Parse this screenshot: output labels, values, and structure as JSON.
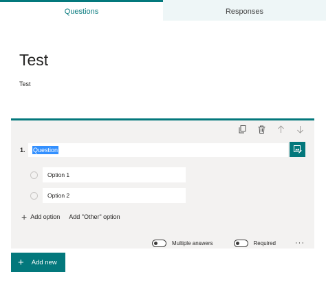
{
  "tabs": [
    {
      "label": "Questions",
      "active": true
    },
    {
      "label": "Responses",
      "active": false
    }
  ],
  "form": {
    "title": "Test",
    "description": "Test"
  },
  "question": {
    "number": "1.",
    "text": "Question",
    "options": [
      {
        "label": "Option 1"
      },
      {
        "label": "Option 2"
      }
    ],
    "add_option_label": "Add option",
    "add_other_label": "Add \"Other\" option",
    "multiple_answers_label": "Multiple answers",
    "multiple_answers_on": false,
    "required_label": "Required",
    "required_on": false,
    "more_label": "···"
  },
  "add_new_label": "Add new",
  "colors": {
    "accent": "#03787c",
    "card_bg": "#f3f2f1",
    "selection": "#3390ff"
  },
  "icons": [
    "copy-icon",
    "delete-icon",
    "arrow-up-icon",
    "arrow-down-icon",
    "insert-media-icon",
    "plus-icon"
  ]
}
